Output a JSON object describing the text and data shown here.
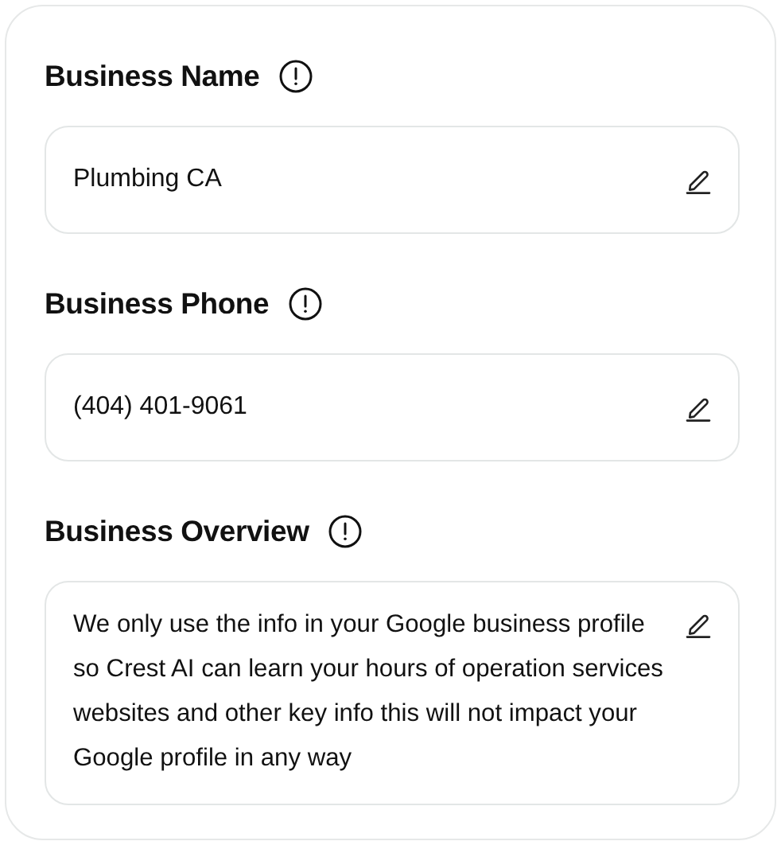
{
  "fields": [
    {
      "label": "Business Name",
      "kind": "line",
      "value": "Plumbing CA"
    },
    {
      "label": "Business Phone",
      "kind": "line",
      "value": "(404) 401-9061"
    },
    {
      "label": "Business Overview",
      "kind": "multiline",
      "value": "We only use the info in your Google business profile  so Crest AI can learn your hours of operation services websites and other key info this will not impact your Google profile in any way"
    }
  ]
}
